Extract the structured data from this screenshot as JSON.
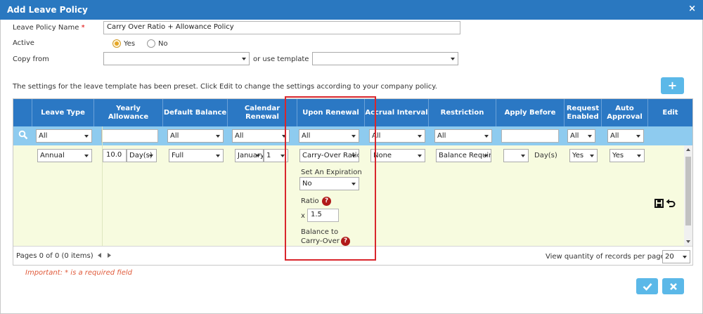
{
  "window": {
    "title": "Add Leave Policy",
    "close": "×"
  },
  "form": {
    "name_label": "Leave Policy Name",
    "required_mark": "*",
    "name_value": "Carry Over Ratio + Allowance Policy",
    "active_label": "Active",
    "active_yes": "Yes",
    "active_no": "No",
    "copy_from_label": "Copy from",
    "copy_from_value": "",
    "or_use_template": "or use template",
    "template_value": "",
    "preset_note": "The settings for the leave template has been preset. Click Edit to change the settings according to your company policy."
  },
  "add_button": "+",
  "grid": {
    "headers": [
      "Leave Type",
      "Yearly Allowance",
      "Default Balance",
      "Calendar Renewal",
      "Upon Renewal",
      "Accrual Interval",
      "Restriction",
      "Apply Before",
      "Request Enabled",
      "Auto Approval",
      "Edit"
    ],
    "filters": {
      "leave_type": "All",
      "yearly_allowance": "",
      "default_balance": "All",
      "calendar_renewal": "All",
      "upon_renewal": "All",
      "accrual_interval": "All",
      "restriction": "All",
      "apply_before": "",
      "request_enabled": "All",
      "auto_approval": "All"
    },
    "row": {
      "leave_type": "Annual",
      "allowance_value": "10.0",
      "allowance_unit": "Day(s)",
      "default_balance": "Full",
      "renewal_month": "January",
      "renewal_day": "1",
      "upon_renewal": "Carry-Over Ratio",
      "set_expiration_label": "Set An Expiration",
      "set_expiration_value": "No",
      "ratio_label": "Ratio",
      "ratio_prefix": "x",
      "ratio_value": "1.5",
      "balance_label_1": "Balance to",
      "balance_label_2": "Carry-Over",
      "accrual_interval": "None",
      "restriction": "Balance Required",
      "apply_before_value": "",
      "apply_before_unit": "Day(s)",
      "request_enabled": "Yes",
      "auto_approval": "Yes",
      "help": "?"
    },
    "pager_text": "Pages 0 of 0 (0 items)",
    "records_label": "View quantity of records per page",
    "records_value": "20"
  },
  "important_note": "Important: * is a required field",
  "colors": {
    "header": "#2b78c4",
    "filter_row": "#8ecbef",
    "data_row": "#f7fbdf",
    "highlight": "#d9262c",
    "button": "#5bb8e8"
  }
}
